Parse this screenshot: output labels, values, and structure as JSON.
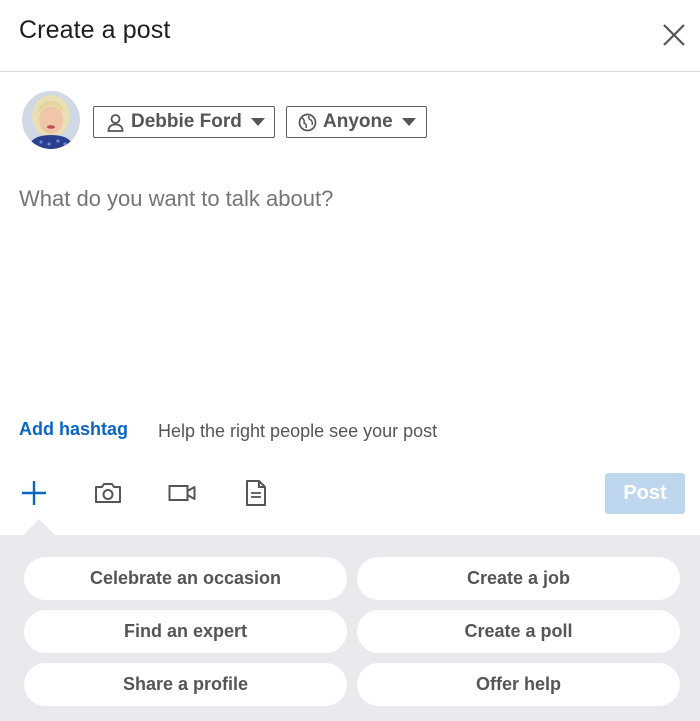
{
  "header": {
    "title": "Create a post"
  },
  "author": {
    "name": "Debbie Ford",
    "icon": "person-icon"
  },
  "audience": {
    "label": "Anyone",
    "icon": "globe-icon"
  },
  "composer": {
    "placeholder": "What do you want to talk about?",
    "value": ""
  },
  "hashtag": {
    "add_label": "Add hashtag",
    "help_text": "Help the right people see your post"
  },
  "toolbar": {
    "icons": [
      "plus-icon",
      "camera-icon",
      "video-icon",
      "document-icon"
    ],
    "post_label": "Post",
    "post_enabled": false
  },
  "colors": {
    "accent": "#0a66c2",
    "post_disabled": "#bfd7ee",
    "panel": "#e9eaee"
  },
  "quick_actions": [
    {
      "label": "Celebrate an occasion"
    },
    {
      "label": "Create a job"
    },
    {
      "label": "Find an expert"
    },
    {
      "label": "Create a poll"
    },
    {
      "label": "Share a profile"
    },
    {
      "label": "Offer help"
    }
  ]
}
